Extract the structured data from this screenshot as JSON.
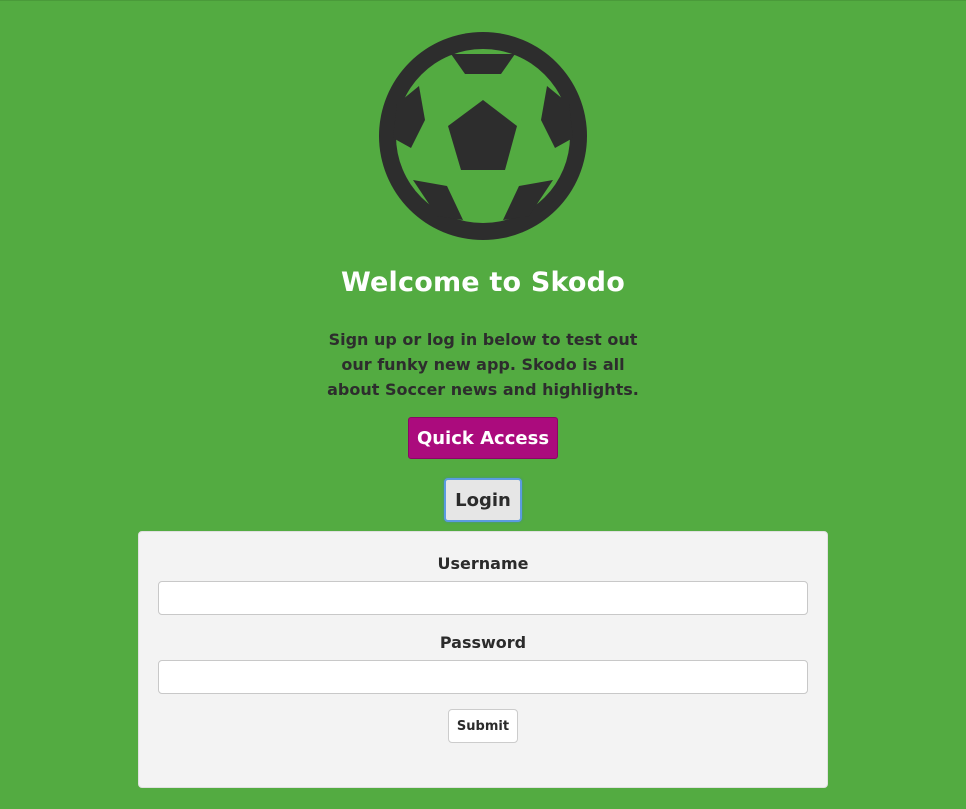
{
  "hero": {
    "logo_icon": "soccer-ball-icon",
    "title": "Welcome to Skodo",
    "intro": "Sign up or log in below to test out our funky new app. Skodo is all about Soccer news and highlights."
  },
  "actions": {
    "quick_access_label": "Quick Access",
    "login_label": "Login"
  },
  "login_form": {
    "username_label": "Username",
    "username_value": "",
    "password_label": "Password",
    "password_value": "",
    "submit_label": "Submit"
  },
  "colors": {
    "background": "#53ab41",
    "accent": "#ab0b7d",
    "panel": "#f3f3f3",
    "ball": "#2d2d2d",
    "focus_ring": "#5b9be0"
  }
}
